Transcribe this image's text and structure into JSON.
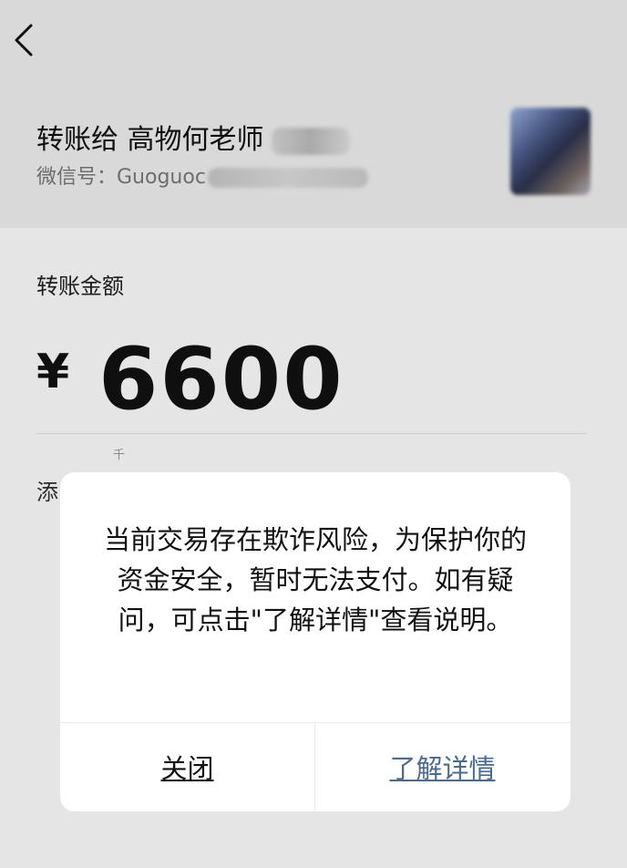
{
  "header": {
    "back_icon": "chevron-left-icon",
    "recipient_label": "转账给 高物何老师",
    "wechat_id_label": "微信号：Guoguoc"
  },
  "transfer": {
    "amount_label": "转账金额",
    "currency_symbol": "¥",
    "amount_value": "6600",
    "unit_hint": "千",
    "add_note_partial": "添"
  },
  "dialog": {
    "message": "当前交易存在欺诈风险，为保护你的资金安全，暂时无法支付。如有疑问，可点击\"了解详情\"查看说明。",
    "close_label": "关闭",
    "details_label": "了解详情",
    "details_color": "#4a6b8d"
  }
}
